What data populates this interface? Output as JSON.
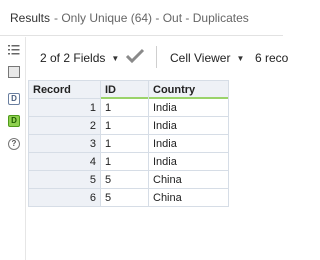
{
  "header": {
    "title": "Results",
    "subtitle": "-  Only Unique (64) - Out - Duplicates"
  },
  "rail": {
    "icons": [
      "list-icon",
      "table-icon",
      "document-icon",
      "data-icon",
      "help-icon"
    ],
    "doc_letter": "D",
    "data_letter": "D",
    "help_letter": "?"
  },
  "toolbar": {
    "fields_label": "2 of 2 Fields",
    "viewer_label": "Cell Viewer",
    "records_label": "6 reco",
    "check_color": "#8a8a8a"
  },
  "table": {
    "columns": [
      "Record",
      "ID",
      "Country"
    ],
    "rows": [
      {
        "record": "1",
        "id": "1",
        "country": "India"
      },
      {
        "record": "2",
        "id": "1",
        "country": "India"
      },
      {
        "record": "3",
        "id": "1",
        "country": "India"
      },
      {
        "record": "4",
        "id": "1",
        "country": "India"
      },
      {
        "record": "5",
        "id": "5",
        "country": "China"
      },
      {
        "record": "6",
        "id": "5",
        "country": "China"
      }
    ]
  },
  "colors": {
    "accent_underline": "#9ad36a",
    "active_icon": "#8fd14f"
  }
}
